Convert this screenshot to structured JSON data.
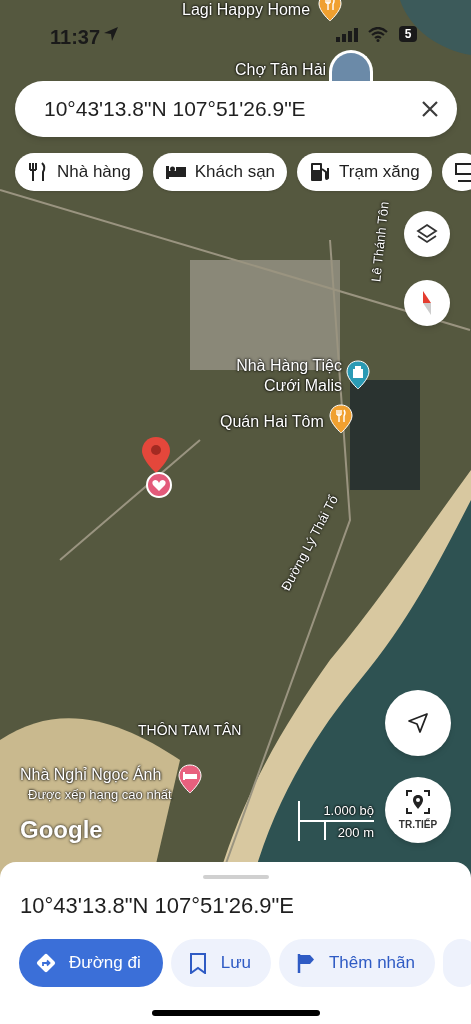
{
  "status_bar": {
    "time": "11:37",
    "battery": "5"
  },
  "search": {
    "value": "10°43'13.8\"N 107°51'26.9\"E"
  },
  "categories": [
    {
      "label": "Nhà hàng",
      "kind": "restaurant"
    },
    {
      "label": "Khách sạn",
      "kind": "hotel"
    },
    {
      "label": "Trạm xăng",
      "kind": "gas"
    },
    {
      "kind": "cafe"
    }
  ],
  "map_labels": [
    {
      "text": "Lagi Happy Home",
      "kind": "food"
    },
    {
      "text": "Chợ Tân Hải",
      "kind": "photo"
    },
    {
      "text": "Lê Thánh Tôn",
      "kind": "road"
    },
    {
      "text": "Nhà Hàng Tiệc Cưới Malis",
      "kind": "venue"
    },
    {
      "text": "Quán Hai Tôm",
      "kind": "food"
    },
    {
      "text": "Đường Lý Thái Tổ",
      "kind": "road"
    },
    {
      "text": "THÔN TAM TÂN",
      "kind": "area"
    },
    {
      "text": "Nhà Nghỉ Ngọc Ánh",
      "subtitle": "Được xếp hạng cao nhất",
      "kind": "hotel"
    }
  ],
  "scale": {
    "imperial": "1.000 bộ",
    "metric": "200 m"
  },
  "logo": "Google",
  "live_view_button": "TR.TIẾP",
  "place_sheet": {
    "title": "10°43'13.8\"N 107°51'26.9\"E",
    "actions": [
      {
        "label": "Đường đi",
        "kind": "directions"
      },
      {
        "label": "Lưu",
        "kind": "save"
      },
      {
        "label": "Thêm nhãn",
        "kind": "label"
      },
      {
        "kind": "more"
      }
    ]
  }
}
